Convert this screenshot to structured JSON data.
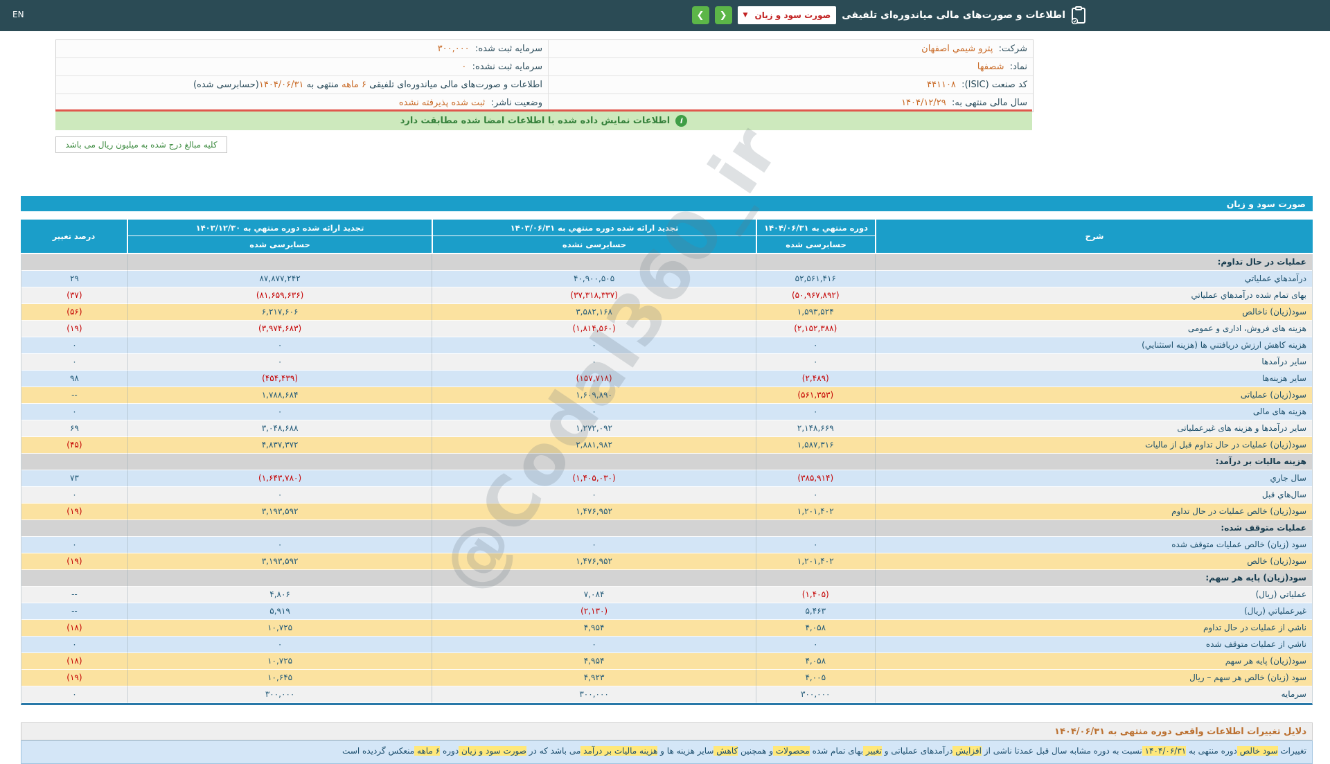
{
  "topbar": {
    "en_label": "EN",
    "title": "اطلاعات و صورت‌های مالی میاندوره‌ای تلفیقی",
    "dropdown_value": "صورت سود و زیان",
    "nav_prev": "❮",
    "nav_next": "❯"
  },
  "info": {
    "rows": [
      {
        "right": [
          [
            "شرکت:  ",
            "t"
          ],
          [
            "پترو شیمي اصفهان",
            "v"
          ]
        ],
        "left": [
          [
            "سرمایه ثبت شده:  ",
            "t"
          ],
          [
            "۳۰۰,۰۰۰",
            "v"
          ]
        ]
      },
      {
        "right": [
          [
            "نماد:  ",
            "t"
          ],
          [
            "شصفها",
            "v"
          ]
        ],
        "left": [
          [
            "سرمایه ثبت نشده:  ",
            "t"
          ],
          [
            "۰",
            "v"
          ]
        ]
      },
      {
        "right": [
          [
            "کد صنعت (ISIC):  ",
            "t"
          ],
          [
            "۴۴۱۱۰۸",
            "v"
          ]
        ],
        "left": [
          [
            "اطلاعات و صورت‌های مالی میاندوره‌ای تلفیقی ",
            "t"
          ],
          [
            "۶ ماهه",
            "v"
          ],
          [
            " منتهی به ",
            "t"
          ],
          [
            "۱۴۰۴/۰۶/۳۱",
            "v"
          ],
          [
            "(حسابرسی شده)",
            "t"
          ]
        ]
      },
      {
        "right": [
          [
            "سال مالی منتهی به:  ",
            "t"
          ],
          [
            "۱۴۰۴/۱۲/۲۹",
            "v"
          ]
        ],
        "left": [
          [
            "وضعیت ناشر:  ",
            "t"
          ],
          [
            "ثبت شده پذیرفته نشده",
            "v"
          ]
        ]
      }
    ]
  },
  "alert": {
    "text": "اطلاعات نمایش داده شده با اطلاعات امضا شده مطابقت دارد",
    "icon": "i"
  },
  "note_box": {
    "text": "کلیه مبالغ درج شده به میلیون ریال می باشد"
  },
  "watermark": {
    "text": "@Codal360_ir"
  },
  "table": {
    "title": "صورت سود و زیان",
    "columns": {
      "desc": "شرح",
      "col1": {
        "period": "دوره منتهي به ۱۴۰۴/۰۶/۳۱",
        "audit": "حسابرسی شده"
      },
      "col2": {
        "period": "تجدید ارائه شده دوره منتهي به ۱۴۰۳/۰۶/۳۱",
        "audit": "حسابرسی نشده"
      },
      "col3": {
        "period": "تجدید ارائه شده دوره منتهي به ۱۴۰۳/۱۲/۳۰",
        "audit": "حسابرسی شده"
      },
      "pct": "درصد تغییر"
    },
    "rows": [
      {
        "type": "section",
        "label": "عملیات در حال تداوم:"
      },
      {
        "type": "data",
        "bg": "blue",
        "label": "درآمدهاي عملياتي",
        "v1": "۵۲,۵۶۱,۴۱۶",
        "v2": "۴۰,۹۰۰,۵۰۵",
        "v3": "۸۷,۸۷۷,۲۴۲",
        "pct": "۲۹"
      },
      {
        "type": "data",
        "bg": "white",
        "label": "بهای تمام شده درآمدهاي عملياتي",
        "v1": "(۵۰,۹۶۷,۸۹۲)",
        "v2": "(۳۷,۳۱۸,۳۳۷)",
        "v3": "(۸۱,۶۵۹,۶۳۶)",
        "pct": "(۳۷)"
      },
      {
        "type": "data",
        "bg": "yellow",
        "label": "سود(زيان) ناخالص",
        "v1": "۱,۵۹۳,۵۲۴",
        "v2": "۳,۵۸۲,۱۶۸",
        "v3": "۶,۲۱۷,۶۰۶",
        "pct": "(۵۶)"
      },
      {
        "type": "data",
        "bg": "white",
        "label": "هزینه های فروش، اداری و عمومی",
        "v1": "(۲,۱۵۲,۳۸۸)",
        "v2": "(۱,۸۱۴,۵۶۰)",
        "v3": "(۳,۹۷۴,۶۸۳)",
        "pct": "(۱۹)"
      },
      {
        "type": "data",
        "bg": "blue",
        "label": "هزینه کاهش ارزش دریافتني ها (هزینه استثنایي)",
        "v1": "۰",
        "v2": "۰",
        "v3": "۰",
        "pct": "۰"
      },
      {
        "type": "data",
        "bg": "white",
        "label": "سایر درآمدها",
        "v1": "۰",
        "v2": "۰",
        "v3": "۰",
        "pct": "۰"
      },
      {
        "type": "data",
        "bg": "blue",
        "label": "سایر هزینه‌ها",
        "v1": "(۲,۴۸۹)",
        "v2": "(۱۵۷,۷۱۸)",
        "v3": "(۴۵۴,۴۳۹)",
        "pct": "۹۸"
      },
      {
        "type": "data",
        "bg": "yellow",
        "label": "سود(زيان) عملياتی",
        "v1": "(۵۶۱,۳۵۳)",
        "v2": "۱,۶۰۹,۸۹۰",
        "v3": "۱,۷۸۸,۶۸۴",
        "pct": "--"
      },
      {
        "type": "data",
        "bg": "blue",
        "label": "هزینه های مالی",
        "v1": "۰",
        "v2": "۰",
        "v3": "۰",
        "pct": "۰"
      },
      {
        "type": "data",
        "bg": "white",
        "label": "سایر درآمدها و هزینه های غیرعملیاتی",
        "v1": "۲,۱۴۸,۶۶۹",
        "v2": "۱,۲۷۲,۰۹۲",
        "v3": "۳,۰۴۸,۶۸۸",
        "pct": "۶۹"
      },
      {
        "type": "data",
        "bg": "yellow",
        "label": "سود(زيان) عملیات در حال تداوم قبل از مالیات",
        "v1": "۱,۵۸۷,۳۱۶",
        "v2": "۲,۸۸۱,۹۸۲",
        "v3": "۴,۸۳۷,۳۷۲",
        "pct": "(۴۵)"
      },
      {
        "type": "section",
        "label": "هزینه مالیات بر درآمد:"
      },
      {
        "type": "data",
        "bg": "blue",
        "label": "سال جاري",
        "v1": "(۳۸۵,۹۱۴)",
        "v2": "(۱,۴۰۵,۰۳۰)",
        "v3": "(۱,۶۴۳,۷۸۰)",
        "pct": "۷۳"
      },
      {
        "type": "data",
        "bg": "white",
        "label": "سال‌هاي قبل",
        "v1": "۰",
        "v2": "۰",
        "v3": "۰",
        "pct": "۰"
      },
      {
        "type": "data",
        "bg": "yellow",
        "label": "سود(زيان) خالص عملیات در حال تداوم",
        "v1": "۱,۲۰۱,۴۰۲",
        "v2": "۱,۴۷۶,۹۵۲",
        "v3": "۳,۱۹۳,۵۹۲",
        "pct": "(۱۹)"
      },
      {
        "type": "section",
        "label": "عملیات متوقف شده:"
      },
      {
        "type": "data",
        "bg": "blue",
        "label": "سود (زیان) خالص عملیات متوقف شده",
        "v1": "۰",
        "v2": "۰",
        "v3": "۰",
        "pct": "۰"
      },
      {
        "type": "data",
        "bg": "yellow",
        "label": "سود(زيان) خالص",
        "v1": "۱,۲۰۱,۴۰۲",
        "v2": "۱,۴۷۶,۹۵۲",
        "v3": "۳,۱۹۳,۵۹۲",
        "pct": "(۱۹)"
      },
      {
        "type": "section",
        "label": "سود(زیان) پایه هر سهم:"
      },
      {
        "type": "data",
        "bg": "white",
        "label": "عملياتي (ريال)",
        "v1": "(۱,۴۰۵)",
        "v2": "۷,۰۸۴",
        "v3": "۴,۸۰۶",
        "pct": "--"
      },
      {
        "type": "data",
        "bg": "blue",
        "label": "غیرعملیاتي (ريال)",
        "v1": "۵,۴۶۳",
        "v2": "(۲,۱۳۰)",
        "v3": "۵,۹۱۹",
        "pct": "--"
      },
      {
        "type": "data",
        "bg": "yellow",
        "label": "ناشي از عملیات در حال تداوم",
        "v1": "۴,۰۵۸",
        "v2": "۴,۹۵۴",
        "v3": "۱۰,۷۲۵",
        "pct": "(۱۸)"
      },
      {
        "type": "data",
        "bg": "blue",
        "label": "ناشي از عملیات متوقف شده",
        "v1": "۰",
        "v2": "۰",
        "v3": "۰",
        "pct": "۰"
      },
      {
        "type": "data",
        "bg": "yellow",
        "label": "سود(زيان) پایه هر سهم",
        "v1": "۴,۰۵۸",
        "v2": "۴,۹۵۴",
        "v3": "۱۰,۷۲۵",
        "pct": "(۱۸)"
      },
      {
        "type": "data",
        "bg": "yellow",
        "label": "سود (زیان) خالص هر سهم – ریال",
        "v1": "۴,۰۰۵",
        "v2": "۴,۹۲۳",
        "v3": "۱۰,۶۴۵",
        "pct": "(۱۹)"
      },
      {
        "type": "data",
        "bg": "white",
        "label": "سرمایه",
        "v1": "۳۰۰,۰۰۰",
        "v2": "۳۰۰,۰۰۰",
        "v3": "۳۰۰,۰۰۰",
        "pct": "۰"
      }
    ]
  },
  "footer": {
    "title": "دلایل تغییرات اطلاعات واقعی دوره منتهی به ۱۴۰۴/۰۶/۳۱",
    "clipped_parts": [
      [
        "تغییرات ",
        0
      ],
      [
        "سود خالص ",
        1
      ],
      [
        "دوره منتهی به ",
        0
      ],
      [
        "۱۴۰۴/۰۶/۳۱ ",
        1
      ],
      [
        "نسبت به دوره مشابه سال قبل عمدتا ناشی از ",
        0
      ],
      [
        "افزایش ",
        1
      ],
      [
        "درآمدهای عملیاتی ",
        0
      ],
      [
        "و ",
        0
      ],
      [
        "تغییر ",
        1
      ],
      [
        "بهای تمام شده ",
        0
      ],
      [
        "محصولات ",
        1
      ],
      [
        "و همچنین ",
        0
      ],
      [
        "کاهش ",
        1
      ],
      [
        "سایر هزینه ها ",
        0
      ],
      [
        "و ",
        0
      ],
      [
        "هزینه مالیات بر درآمد ",
        1
      ],
      [
        "می باشد ",
        0
      ],
      [
        "که در ",
        0
      ],
      [
        "صورت سود و زیان ",
        1
      ],
      [
        "دوره ",
        0
      ],
      [
        "۶ ماهه ",
        1
      ],
      [
        "منعکس گردیده است ",
        0
      ]
    ]
  },
  "colors": {
    "topbar_bg": "#2b4b55",
    "accent_teal": "#1b9ec9",
    "nav_green": "#5cb648",
    "row_blue": "#d3e5f6",
    "row_yellow": "#fbe2a0",
    "row_section": "#d3d3d3",
    "negative_red": "#c40000",
    "value_orange": "#c96b28",
    "alert_green_bg": "#cde9bd"
  }
}
